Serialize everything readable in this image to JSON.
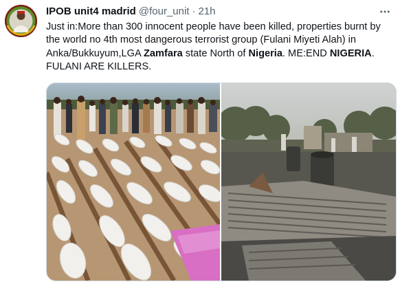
{
  "tweet": {
    "display_name": "IPOB unit4 madrid",
    "handle": "@four_unit",
    "separator": "·",
    "time": "21h",
    "more_icon": "more-horizontal-icon",
    "text_segments": [
      {
        "text": "Just in:More than 300 innocent people have been killed, properties burnt by the world no 4th most dangerous terrorist group (Fulani Miyeti Alah) in Anka/Bukkuyum,LGA ",
        "bold": false
      },
      {
        "text": "Zamfara",
        "bold": true
      },
      {
        "text": " state North of ",
        "bold": false
      },
      {
        "text": "Nigeria",
        "bold": true
      },
      {
        "text": ". ME:END ",
        "bold": false
      },
      {
        "text": "NIGERIA",
        "bold": true
      },
      {
        "text": ". FULANI ARE KILLERS.",
        "bold": false
      }
    ],
    "media": [
      {
        "kind": "photo",
        "subject": "rows of shrouded bodies on wooden planks with a crowd behind"
      },
      {
        "kind": "photo",
        "subject": "burnt village with corrugated roofing sheets and charred barrels"
      }
    ]
  },
  "colors": {
    "text": "#0f1419",
    "secondary": "#536471",
    "border": "#cfd9de",
    "background": "#ffffff"
  }
}
